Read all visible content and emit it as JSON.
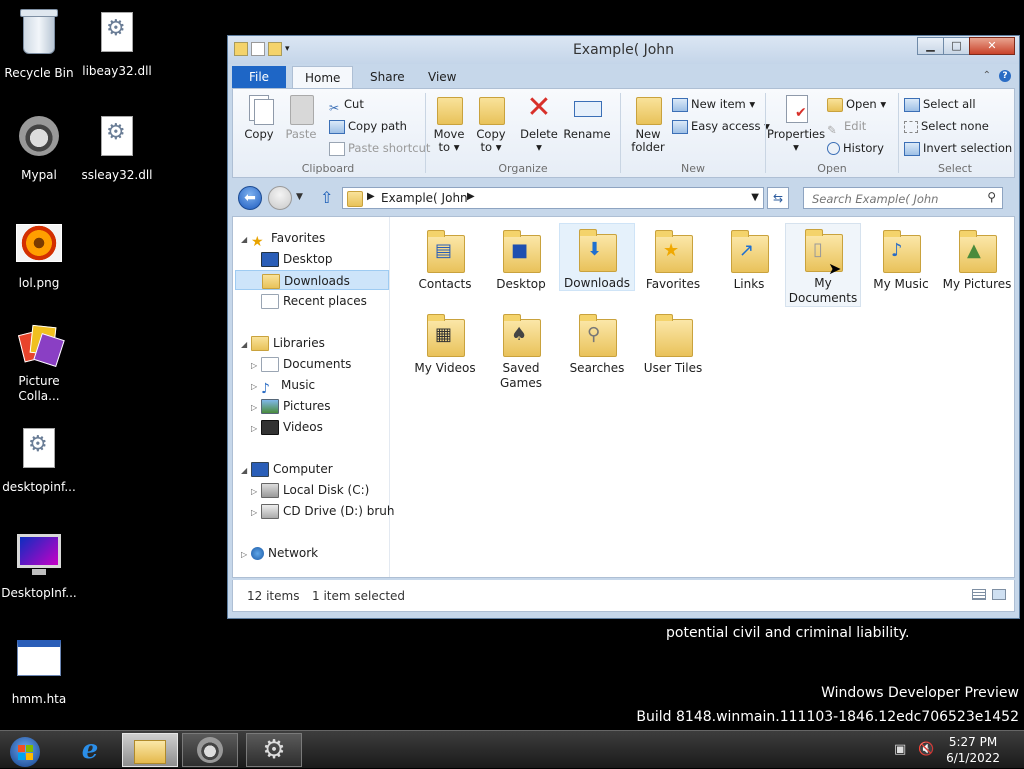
{
  "desktop": {
    "icons": [
      {
        "label": "Recycle Bin"
      },
      {
        "label": "libeay32.dll"
      },
      {
        "label": "Mypal"
      },
      {
        "label": "ssleay32.dll"
      },
      {
        "label": "lol.png"
      },
      {
        "label": "Picture Colla..."
      },
      {
        "label": "desktopinf..."
      },
      {
        "label": "DesktopInf..."
      },
      {
        "label": "hmm.hta"
      }
    ],
    "legal_text": "potential civil and criminal liability.",
    "watermark_line1": "Windows Developer Preview",
    "watermark_line2": "Build 8148.winmain.111103-1846.12edc706523e1452"
  },
  "window": {
    "title": "Example( John",
    "tabs": {
      "file": "File",
      "home": "Home",
      "share": "Share",
      "view": "View"
    },
    "ribbon": {
      "clipboard": {
        "label": "Clipboard",
        "copy": "Copy",
        "paste": "Paste",
        "cut": "Cut",
        "copy_path": "Copy path",
        "paste_shortcut": "Paste shortcut"
      },
      "organize": {
        "label": "Organize",
        "move_to_1": "Move",
        "move_to_2": "to ▾",
        "copy_to_1": "Copy",
        "copy_to_2": "to ▾",
        "delete": "Delete",
        "delete_dd": "▾",
        "rename": "Rename"
      },
      "new": {
        "label": "New",
        "new_folder_1": "New",
        "new_folder_2": "folder",
        "new_item": "New item ▾",
        "easy_access": "Easy access ▾"
      },
      "open": {
        "label": "Open",
        "properties": "Properties",
        "properties_dd": "▾",
        "open": "Open ▾",
        "edit": "Edit",
        "history": "History"
      },
      "select": {
        "label": "Select",
        "select_all": "Select all",
        "select_none": "Select none",
        "invert": "Invert selection"
      }
    },
    "address": {
      "path": "Example( John",
      "search_placeholder": "Search Example( John"
    },
    "nav": {
      "favorites": "Favorites",
      "desktop": "Desktop",
      "downloads": "Downloads",
      "recent": "Recent places",
      "libraries": "Libraries",
      "documents": "Documents",
      "music": "Music",
      "pictures": "Pictures",
      "videos": "Videos",
      "computer": "Computer",
      "local_disk": "Local Disk (C:)",
      "cd_drive": "CD Drive (D:) bruh",
      "network": "Network"
    },
    "files": [
      {
        "name": "Contacts"
      },
      {
        "name": "Desktop"
      },
      {
        "name": "Downloads"
      },
      {
        "name": "Favorites"
      },
      {
        "name": "Links"
      },
      {
        "name": "My Documents"
      },
      {
        "name": "My Music"
      },
      {
        "name": "My Pictures"
      },
      {
        "name": "My Videos"
      },
      {
        "name": "Saved Games"
      },
      {
        "name": "Searches"
      },
      {
        "name": "User Tiles"
      }
    ],
    "status": {
      "items": "12 items",
      "selected": "1 item selected"
    }
  },
  "taskbar": {
    "time": "5:27 PM",
    "date": "6/1/2022"
  }
}
